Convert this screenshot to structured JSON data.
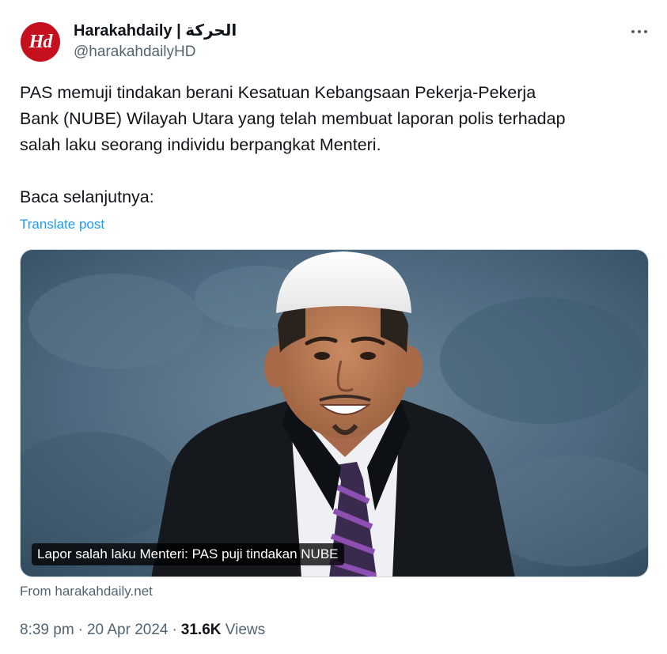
{
  "account": {
    "avatar_text": "Hd",
    "display_name": "Harakahdaily | الحركة",
    "handle": "@harakahdailyHD"
  },
  "post": {
    "text": "PAS memuji tindakan berani Kesatuan Kebangsaan Pekerja-Pekerja\nBank (NUBE) Wilayah Utara yang telah membuat laporan polis terhadap\nsalah laku seorang individu berpangkat Menteri.\n\nBaca selanjutnya:",
    "translate_label": "Translate post"
  },
  "media": {
    "caption": "Lapor salah laku Menteri: PAS puji tindakan NUBE",
    "source": "From harakahdaily.net"
  },
  "meta": {
    "time": "8:39 pm",
    "date": "20 Apr 2024",
    "separator": "·",
    "views_count": "31.6K",
    "views_label": "Views"
  },
  "colors": {
    "avatar": "#c5101d",
    "link": "#1d9bf0",
    "secondary_text": "#536471",
    "background_photo": "#4f6a80"
  },
  "icons": {
    "more": "more-dots-icon"
  }
}
